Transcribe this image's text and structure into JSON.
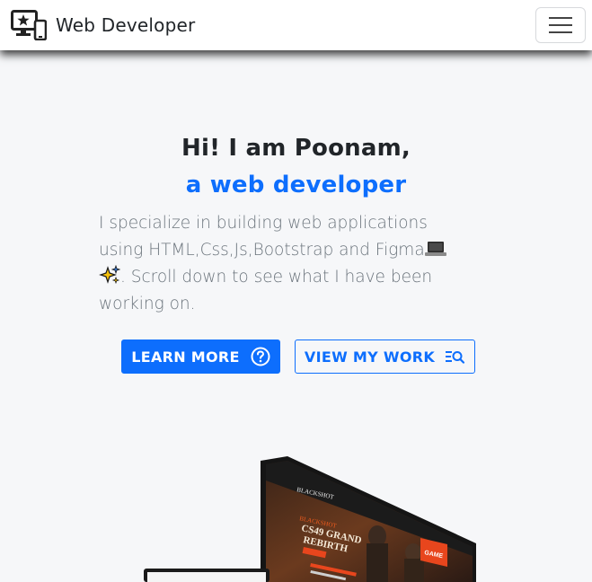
{
  "nav": {
    "brand": "Web Developer",
    "brand_icon": "devices-star-icon",
    "menu_icon": "hamburger-menu-icon"
  },
  "hero": {
    "greeting": "Hi! I am Poonam,",
    "role": "a web developer",
    "desc_line1": "I specialize in building web applications",
    "desc_line2": "using HTML,Css,Js,Bootstrap and Figma",
    "desc_line3": ". Scroll down to see what I have been",
    "desc_line4": "working on."
  },
  "buttons": {
    "learn_more": "LEARN MORE",
    "view_work": "VIEW MY WORK"
  },
  "screen": {
    "brand": "BLACKSHOT",
    "kicker": "BLACKSHOT",
    "headline_1": "CS49 GRAND",
    "headline_2": "REBIRTH",
    "game_label": "GAME"
  },
  "colors": {
    "primary": "#0d6efd",
    "text": "#212529",
    "muted": "#6c757d",
    "background": "#f6f7f9"
  }
}
